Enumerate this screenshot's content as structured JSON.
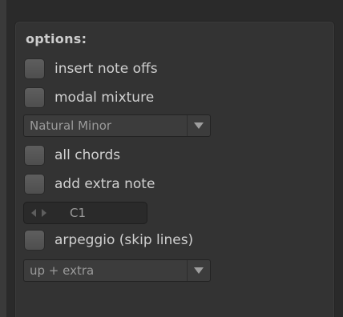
{
  "options": {
    "title": "options:",
    "insert_note_offs": {
      "label": "insert note offs",
      "checked": false
    },
    "modal_mixture": {
      "label": "modal mixture",
      "checked": false
    },
    "scale_select": {
      "value": "Natural Minor"
    },
    "all_chords": {
      "label": "all chords",
      "checked": false
    },
    "add_extra_note": {
      "label": "add extra note",
      "checked": false
    },
    "extra_note_stepper": {
      "value": "C1"
    },
    "arpeggio": {
      "label": "arpeggio (skip lines)",
      "checked": false
    },
    "arpeggio_mode_select": {
      "value": "up + extra"
    }
  },
  "icons": {
    "dropdown_arrow": "triangle-down-icon",
    "stepper_left": "triangle-left-icon",
    "stepper_right": "triangle-right-icon"
  },
  "colors": {
    "panel_bg": "#333333",
    "checkbox": "#575757",
    "text": "#d0d0d0",
    "muted_text": "#9a9a9a"
  }
}
